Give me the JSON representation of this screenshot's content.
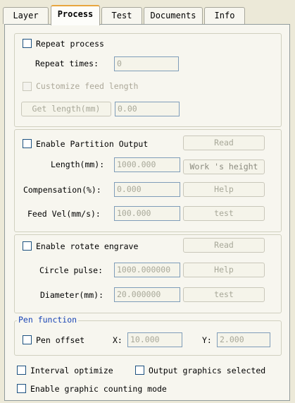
{
  "tabs": [
    {
      "label": "Layer"
    },
    {
      "label": "Process"
    },
    {
      "label": "Test"
    },
    {
      "label": "Documents"
    },
    {
      "label": "Info"
    }
  ],
  "repeat_group": {
    "repeat_process": "Repeat process",
    "repeat_times_label": "Repeat times:",
    "repeat_times_value": "0",
    "customize_feed": "Customize feed length",
    "get_length_button": "Get length(mm)",
    "length_value": "0.00"
  },
  "partition_group": {
    "enable_label": "Enable Partition Output",
    "read_button": "Read",
    "length_label": "Length(mm):",
    "length_value": "1000.000",
    "works_height_button": "Work 's height",
    "compensation_label": "Compensation(%):",
    "compensation_value": "0.000",
    "help_button": "Help",
    "feed_vel_label": "Feed Vel(mm/s):",
    "feed_vel_value": "100.000",
    "test_button": "test"
  },
  "rotate_group": {
    "enable_label": "Enable rotate engrave",
    "read_button": "Read",
    "circle_pulse_label": "Circle pulse:",
    "circle_pulse_value": "1000.000000",
    "help_button": "Help",
    "diameter_label": "Diameter(mm):",
    "diameter_value": "20.000000",
    "test_button": "test"
  },
  "pen_group": {
    "title": "Pen function",
    "pen_offset_label": "Pen offset",
    "x_label": "X:",
    "x_value": "10.000",
    "y_label": "Y:",
    "y_value": "2.000"
  },
  "bottom": {
    "interval_optimize": "Interval optimize",
    "output_selected": "Output graphics selected",
    "graphic_counting": "Enable graphic counting mode"
  }
}
